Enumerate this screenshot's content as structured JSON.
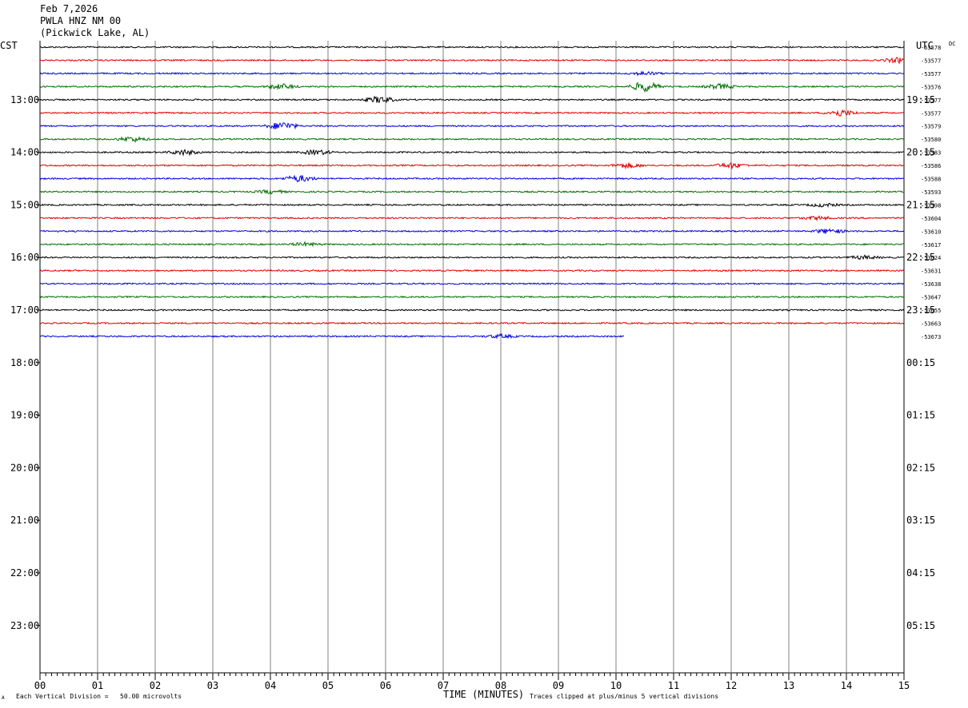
{
  "header": {
    "date": "Feb 7,2026",
    "station": "PWLA HNZ NM 00",
    "location": "(Pickwick Lake, AL)"
  },
  "left_zone": "CST",
  "right_zone": "UTC",
  "dc_label": "DC",
  "footer": {
    "scale_note": "Each Vertical Division =   50.00 microvolts",
    "xlabel": "TIME (MINUTES)",
    "clip_note": "Traces clipped at plus/minus 5 vertical divisions",
    "corner_mark": "A"
  },
  "colors": {
    "trace_cycle": [
      "#000000",
      "#e00000",
      "#0000e0",
      "#007000"
    ],
    "grid": "#808080"
  },
  "chart_data": {
    "type": "line",
    "title": "PWLA HNZ NM 00",
    "xlabel": "TIME (MINUTES)",
    "ylabel": "",
    "x_ticks": [
      "00",
      "01",
      "02",
      "03",
      "04",
      "05",
      "06",
      "07",
      "08",
      "09",
      "10",
      "11",
      "12",
      "13",
      "14",
      "15"
    ],
    "xlim": [
      0,
      15
    ],
    "rows_per_hour": 4,
    "left_hour_labels": [
      "13:00",
      "14:00",
      "15:00",
      "16:00",
      "17:00",
      "18:00",
      "19:00",
      "20:00",
      "21:00",
      "22:00",
      "23:00"
    ],
    "right_hour_labels": [
      "19:15",
      "20:15",
      "21:15",
      "22:15",
      "23:15",
      "00:15",
      "01:15",
      "02:15",
      "03:15",
      "04:15",
      "05:15"
    ],
    "traces": [
      {
        "offset": "-53578",
        "end_minute": 15,
        "events": []
      },
      {
        "offset": "-53577",
        "end_minute": 15,
        "events": [
          {
            "minute": 14.9,
            "amp": 3
          }
        ]
      },
      {
        "offset": "-53577",
        "end_minute": 15,
        "events": [
          {
            "minute": 10.5,
            "amp": 2
          }
        ]
      },
      {
        "offset": "-53576",
        "end_minute": 15,
        "events": [
          {
            "minute": 10.5,
            "amp": 6
          },
          {
            "minute": 4.2,
            "amp": 3
          },
          {
            "minute": 11.8,
            "amp": 3
          }
        ]
      },
      {
        "offset": "-53577",
        "end_minute": 15,
        "events": [
          {
            "minute": 5.9,
            "amp": 4
          }
        ]
      },
      {
        "offset": "-53577",
        "end_minute": 15,
        "events": [
          {
            "minute": 13.9,
            "amp": 4
          }
        ]
      },
      {
        "offset": "-53579",
        "end_minute": 15,
        "events": [
          {
            "minute": 4.2,
            "amp": 5
          }
        ]
      },
      {
        "offset": "-53580",
        "end_minute": 15,
        "events": [
          {
            "minute": 1.6,
            "amp": 3
          }
        ]
      },
      {
        "offset": "-53583",
        "end_minute": 15,
        "events": [
          {
            "minute": 2.5,
            "amp": 3
          },
          {
            "minute": 4.8,
            "amp": 3
          }
        ]
      },
      {
        "offset": "-53586",
        "end_minute": 15,
        "events": [
          {
            "minute": 10.2,
            "amp": 3
          },
          {
            "minute": 12.0,
            "amp": 3
          }
        ]
      },
      {
        "offset": "-53588",
        "end_minute": 15,
        "events": [
          {
            "minute": 4.5,
            "amp": 4
          }
        ]
      },
      {
        "offset": "-53593",
        "end_minute": 15,
        "events": [
          {
            "minute": 4.0,
            "amp": 2
          }
        ]
      },
      {
        "offset": "-53598",
        "end_minute": 15,
        "events": [
          {
            "minute": 13.6,
            "amp": 2
          }
        ]
      },
      {
        "offset": "-53604",
        "end_minute": 15,
        "events": [
          {
            "minute": 13.5,
            "amp": 2
          }
        ]
      },
      {
        "offset": "-53610",
        "end_minute": 15,
        "events": [
          {
            "minute": 13.7,
            "amp": 3
          }
        ]
      },
      {
        "offset": "-53617",
        "end_minute": 15,
        "events": [
          {
            "minute": 4.6,
            "amp": 2
          }
        ]
      },
      {
        "offset": "-53624",
        "end_minute": 15,
        "events": [
          {
            "minute": 14.3,
            "amp": 2
          }
        ]
      },
      {
        "offset": "-53631",
        "end_minute": 15,
        "events": []
      },
      {
        "offset": "-53638",
        "end_minute": 15,
        "events": []
      },
      {
        "offset": "-53647",
        "end_minute": 15,
        "events": []
      },
      {
        "offset": "-53655",
        "end_minute": 15,
        "events": []
      },
      {
        "offset": "-53663",
        "end_minute": 15,
        "events": []
      },
      {
        "offset": "-53673",
        "end_minute": 10.15,
        "events": [
          {
            "minute": 8.0,
            "amp": 2
          }
        ]
      }
    ]
  }
}
